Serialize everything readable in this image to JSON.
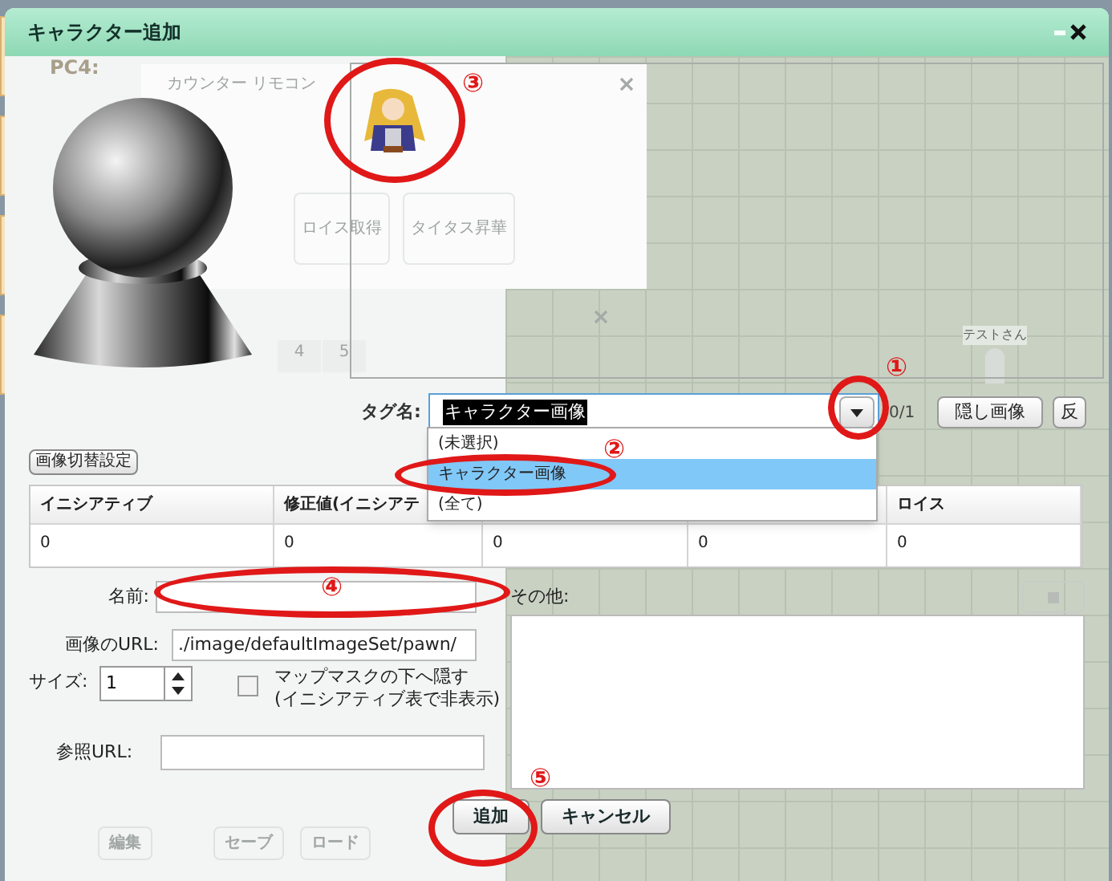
{
  "window": {
    "title": "キャラクター追加"
  },
  "background": {
    "player_label": "PC4:",
    "panel_title": "カウンター リモコン",
    "panel_buttons": [
      "ロイス取得",
      "タイタス昇華"
    ],
    "tabs": [
      "4",
      "5"
    ],
    "bottom_buttons": [
      "編集",
      "セーブ",
      "ロード"
    ],
    "map_marker": "テストさん"
  },
  "tag": {
    "label": "タグ名:",
    "value": "キャラクター画像",
    "expanded": true,
    "options": [
      {
        "label": "(未選択)",
        "selected": false
      },
      {
        "label": "キャラクター画像",
        "selected": true
      },
      {
        "label": "(全て)",
        "selected": false
      }
    ]
  },
  "image_counter": "0/1",
  "image_buttons": [
    "隠し画像",
    "反"
  ],
  "image_switch_button": "画像切替設定",
  "table": {
    "columns": [
      {
        "header": "イニシアティブ"
      },
      {
        "header": "修正値(イニシアテ"
      },
      {},
      {},
      {
        "header": "ロイス"
      }
    ],
    "rows": [
      [
        "0",
        "0",
        "0",
        "0",
        "0"
      ]
    ]
  },
  "form": {
    "name": {
      "label": "名前:"
    },
    "url": {
      "label": "画像のURL:",
      "value": "./image/defaultImageSet/pawn/"
    },
    "size": {
      "label": "サイズ:",
      "value": "1"
    },
    "hide": {
      "lines": [
        "マップマスクの下へ隠す",
        "(イニシアティブ表で非表示)"
      ],
      "checked": false
    },
    "ref_url": {
      "label": "参照URL:"
    },
    "other": {
      "label": "その他:"
    }
  },
  "actions": [
    {
      "label": "追加"
    },
    {
      "label": "キャンセル"
    }
  ],
  "annotations": [
    "①",
    "②",
    "③",
    "④",
    "⑤"
  ]
}
